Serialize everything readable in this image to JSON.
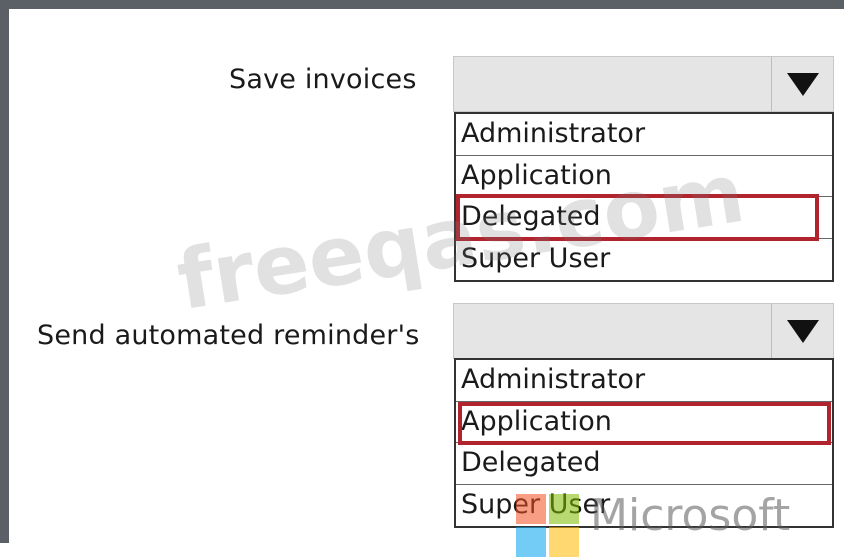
{
  "rows": [
    {
      "label": "Save invoices",
      "selected_value": "",
      "options": [
        "Administrator",
        "Application",
        "Delegated",
        "Super User"
      ],
      "highlighted_option": "Delegated"
    },
    {
      "label": "Send automated reminder's",
      "selected_value": "",
      "options": [
        "Administrator",
        "Application",
        "Delegated",
        "Super User"
      ],
      "highlighted_option": "Application"
    }
  ],
  "icons": {
    "dropdown": "chevron-down-icon",
    "logo": "microsoft-logo-icon"
  },
  "colors": {
    "highlight": "#b1242e",
    "frame": "#5b6066"
  },
  "watermark": {
    "text": "freeqas.com"
  },
  "brand": {
    "text": "Microsoft"
  }
}
